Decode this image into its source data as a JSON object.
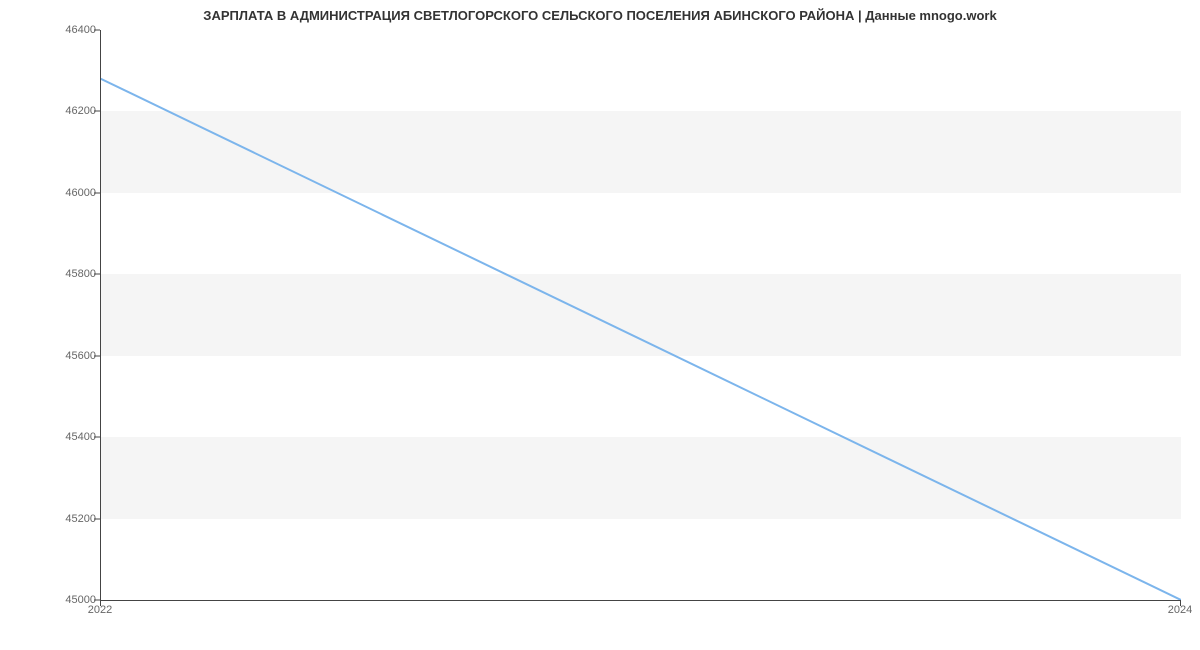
{
  "chart_data": {
    "type": "line",
    "title": "ЗАРПЛАТА В АДМИНИСТРАЦИЯ СВЕТЛОГОРСКОГО СЕЛЬСКОГО ПОСЕЛЕНИЯ АБИНСКОГО РАЙОНА | Данные mnogo.work",
    "xlabel": "",
    "ylabel": "",
    "x": [
      2022,
      2024
    ],
    "values": [
      46280,
      45000
    ],
    "x_ticks": [
      2022,
      2024
    ],
    "y_ticks": [
      45000,
      45200,
      45400,
      45600,
      45800,
      46000,
      46200,
      46400
    ],
    "ylim": [
      45000,
      46400
    ],
    "xlim": [
      2022,
      2024
    ],
    "line_color": "#7cb5ec",
    "band_color": "#f5f5f5"
  }
}
